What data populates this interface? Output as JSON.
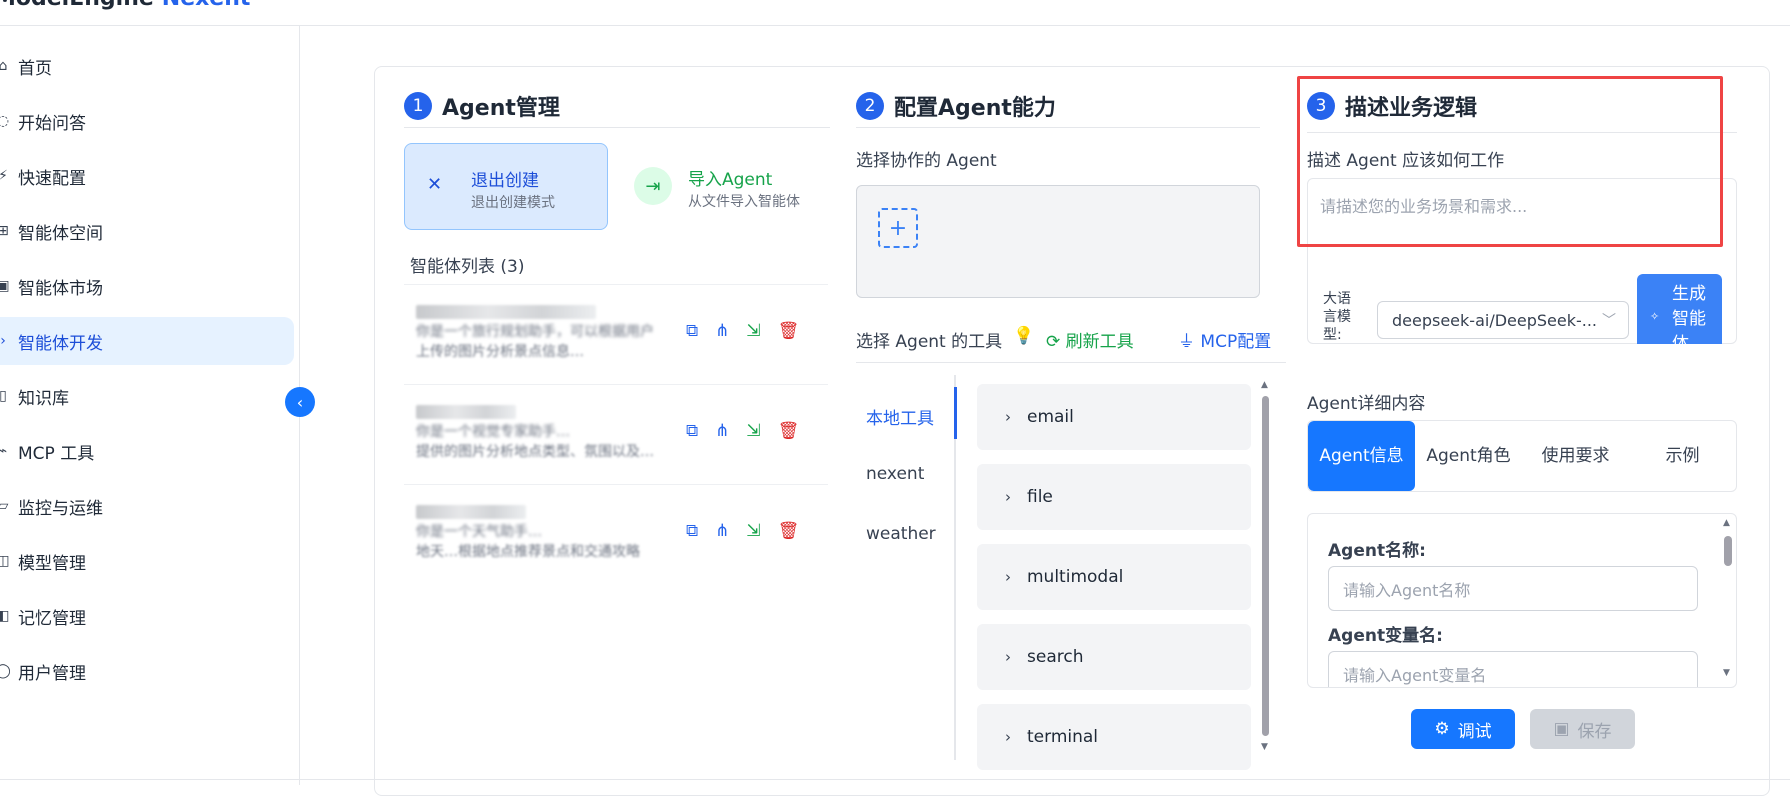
{
  "app": {
    "logo_text": "ModelEngine",
    "brand": "Nexent"
  },
  "sidebar": {
    "items": [
      {
        "label": "首页",
        "icon": "home-icon",
        "glyph": "⌂"
      },
      {
        "label": "开始问答",
        "icon": "chat-icon",
        "glyph": "◌"
      },
      {
        "label": "快速配置",
        "icon": "lightning-icon",
        "glyph": "⚡"
      },
      {
        "label": "智能体空间",
        "icon": "grid-icon",
        "glyph": "⊞"
      },
      {
        "label": "智能体市场",
        "icon": "shop-icon",
        "glyph": "▣"
      },
      {
        "label": "智能体开发",
        "icon": "code-icon",
        "glyph": "›"
      },
      {
        "label": "知识库",
        "icon": "book-icon",
        "glyph": "▯"
      },
      {
        "label": "MCP 工具",
        "icon": "plug-icon",
        "glyph": "⌁"
      },
      {
        "label": "监控与运维",
        "icon": "monitor-icon",
        "glyph": "▱"
      },
      {
        "label": "模型管理",
        "icon": "cube-icon",
        "glyph": "◫"
      },
      {
        "label": "记忆管理",
        "icon": "memory-icon",
        "glyph": "◧"
      },
      {
        "label": "用户管理",
        "icon": "user-icon",
        "glyph": "◯"
      }
    ],
    "active_index": 5,
    "collapse_glyph": "‹"
  },
  "agent_mgmt": {
    "step": "1",
    "title": "Agent管理",
    "exit_glyph": "✕",
    "exit_title": "退出创建",
    "exit_sub": "退出创建模式",
    "import_glyph": "⇥",
    "import_title": "导入Agent",
    "import_sub": "从文件导入智能体",
    "list_title": "智能体列表 (3)",
    "agents": [
      {
        "desc_line1": "你是一个旅行规划助手，可以根据用户",
        "desc_line2": "上传的图片分析景点信息…"
      },
      {
        "desc_line1": "你是一个视觉专家助手…",
        "desc_line2": "提供的图片分析地点类型、氛围以及…"
      },
      {
        "desc_line1": "你是一个天气助手…",
        "desc_line2": "地天…根据地点推荐景点和交通攻略"
      }
    ],
    "row_icons": {
      "copy": "⧉",
      "tree": "⋔",
      "export": "⇲",
      "delete": "🗑"
    }
  },
  "capabilities": {
    "step": "2",
    "title": "配置Agent能力",
    "collab_label": "选择协作的 Agent",
    "add_glyph": "+",
    "tools_label": "选择 Agent 的工具",
    "bulb_glyph": "💡",
    "refresh_label": "⟳ 刷新工具",
    "mcp_label": "⏚ MCP配置",
    "tool_tabs": [
      "本地工具",
      "nexent",
      "weather"
    ],
    "tools": [
      "email",
      "file",
      "multimodal",
      "search",
      "terminal"
    ],
    "chevron": "›"
  },
  "business": {
    "step": "3",
    "title": "描述业务逻辑",
    "desc_label": "描述 Agent 应该如何工作",
    "desc_placeholder": "请描述您的业务场景和需求...",
    "llm_label": "大语言模型:",
    "model_value": "deepseek-ai/DeepSeek-...",
    "dropdown_glyph": "﹀",
    "generate_label": "生成智能体",
    "spark_glyph": "✧",
    "detail_label": "Agent详细内容",
    "detail_tabs": [
      "Agent信息",
      "Agent角色",
      "使用要求",
      "示例"
    ],
    "name_label": "Agent名称:",
    "name_placeholder": "请输入Agent名称",
    "var_label": "Agent变量名:",
    "var_placeholder": "请输入Agent变量名",
    "debug_label": "调试",
    "debug_glyph": "⚙",
    "save_label": "保存",
    "save_glyph": "▣"
  },
  "colors": {
    "accent": "#1677ff",
    "highlight": "#ef4444",
    "green": "#16a34a",
    "danger": "#dc2626"
  }
}
